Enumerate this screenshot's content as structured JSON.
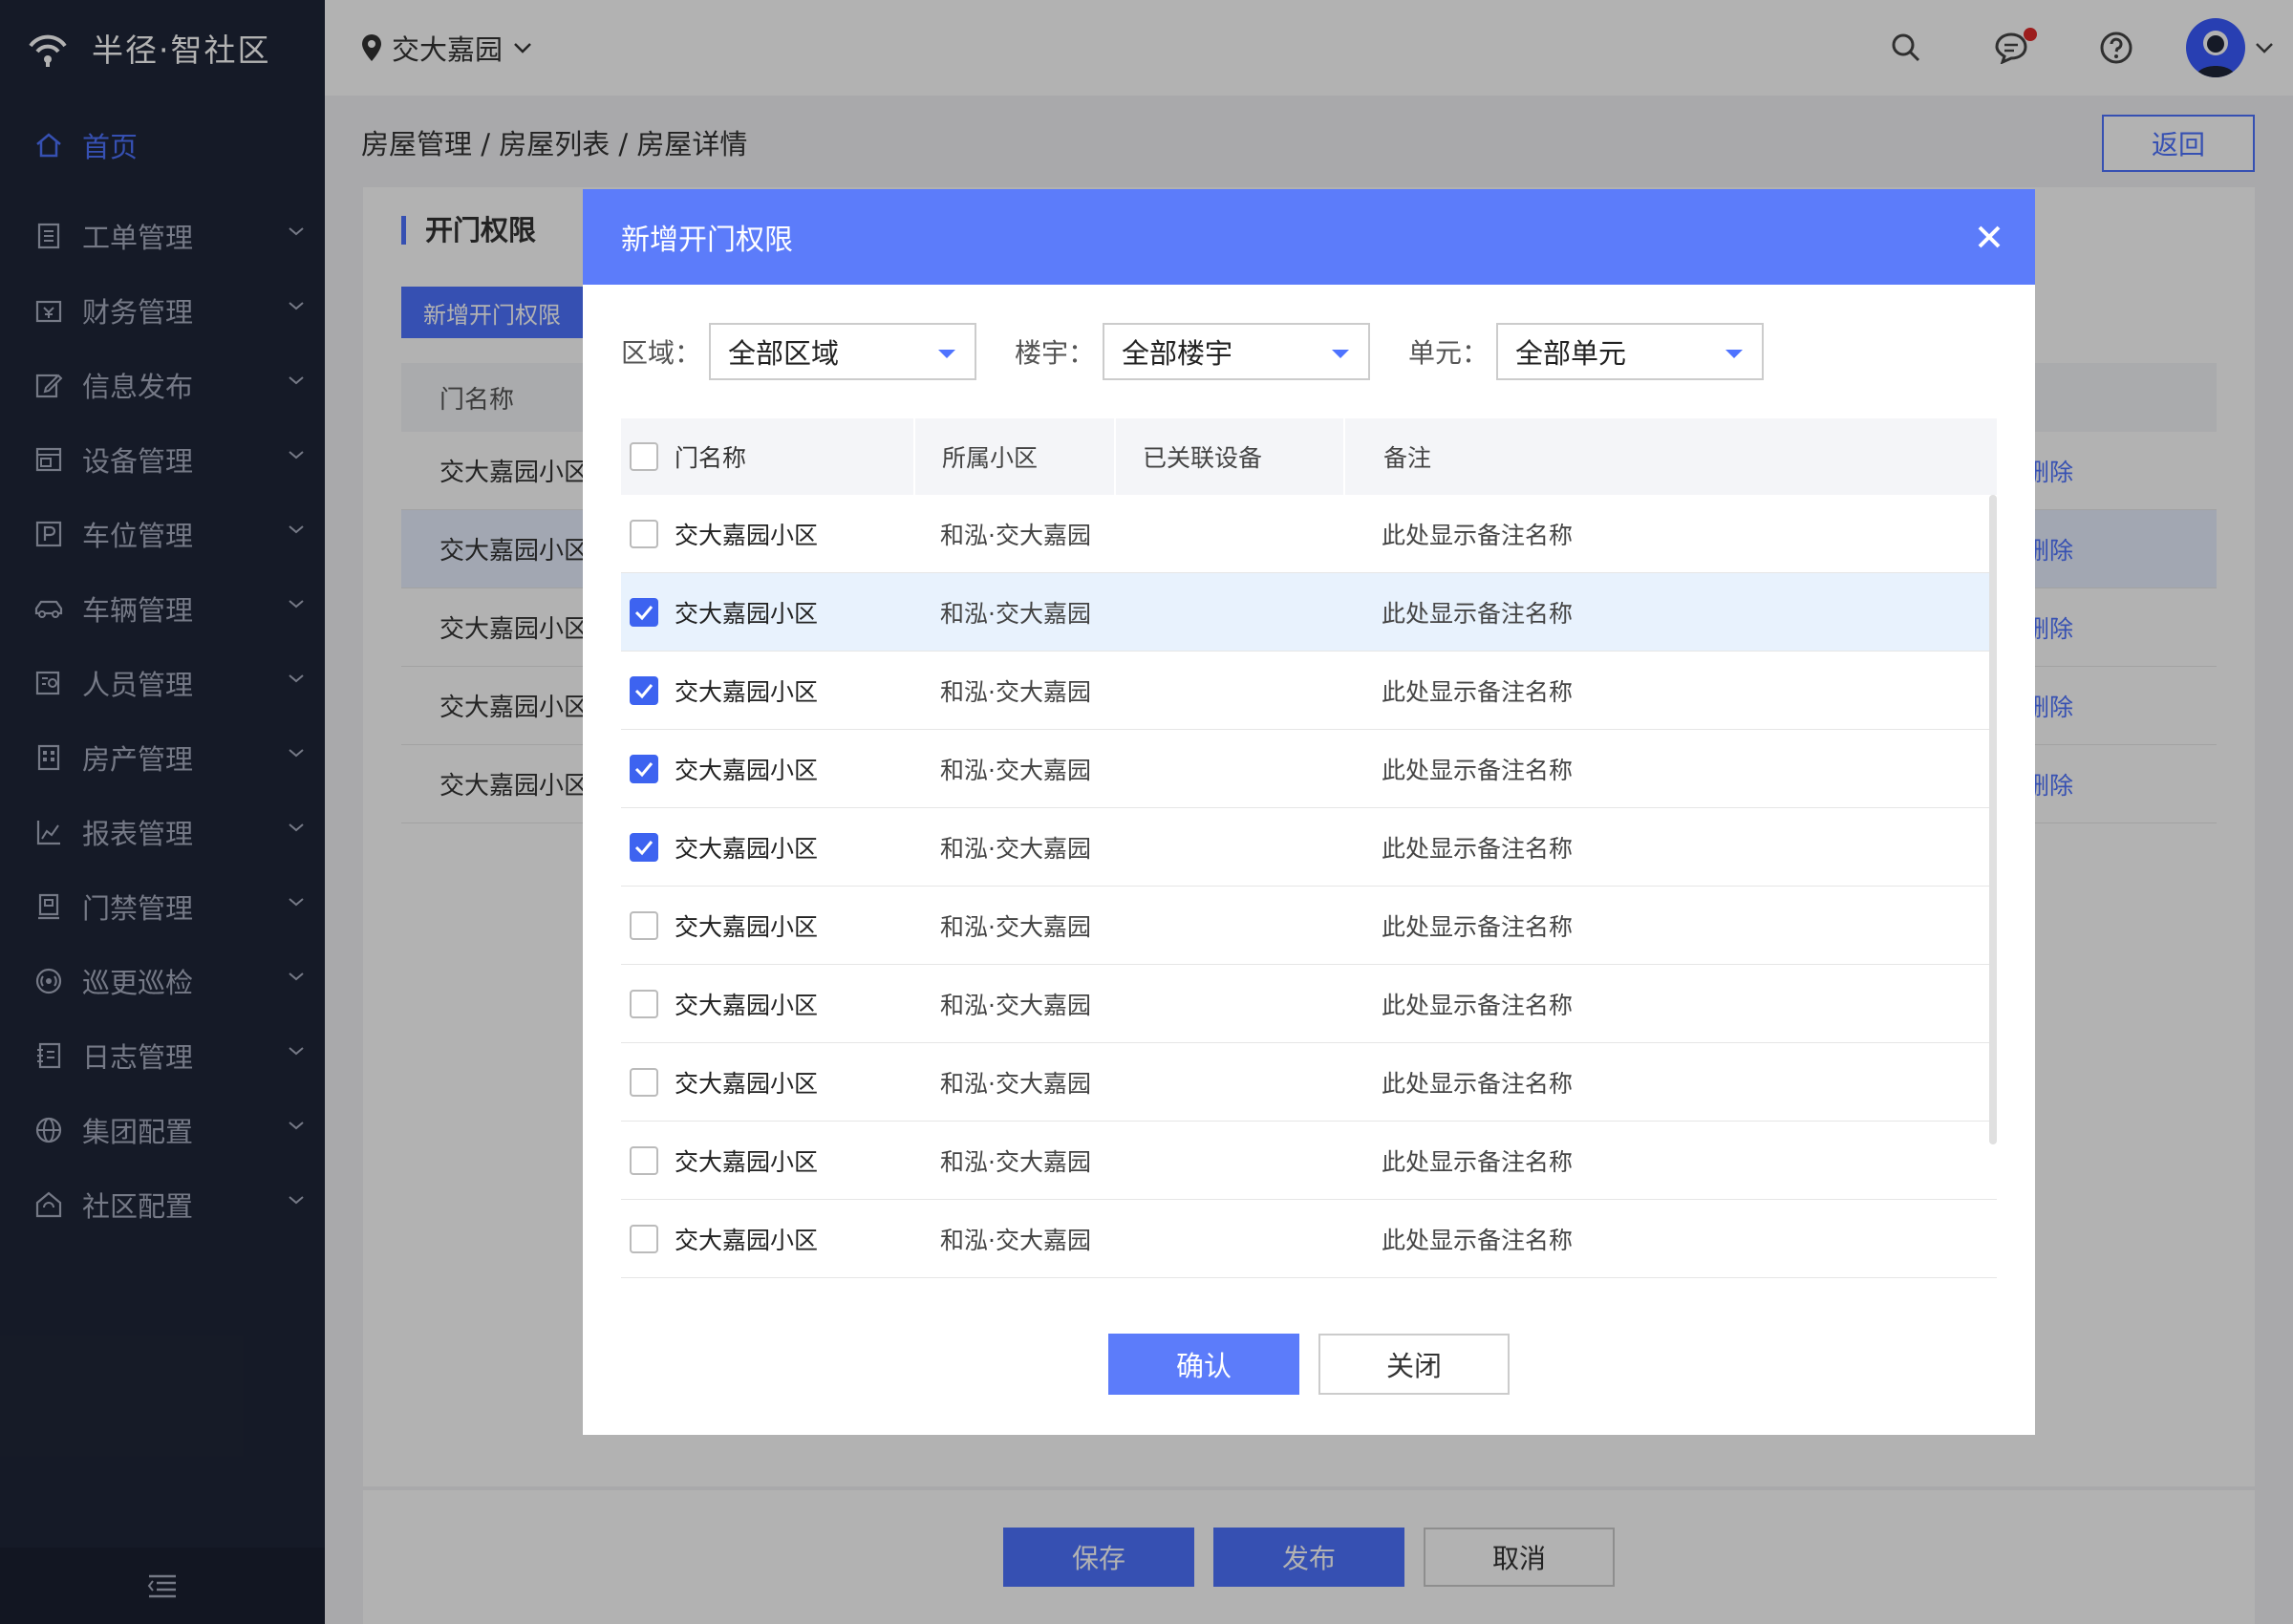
{
  "app": {
    "name": "半径·智社区"
  },
  "sidebar": {
    "items": [
      {
        "label": "首页",
        "icon": "home-icon",
        "active": true
      },
      {
        "label": "工单管理",
        "icon": "ticket-icon"
      },
      {
        "label": "财务管理",
        "icon": "finance-icon"
      },
      {
        "label": "信息发布",
        "icon": "edit-icon"
      },
      {
        "label": "设备管理",
        "icon": "device-icon"
      },
      {
        "label": "车位管理",
        "icon": "parking-icon"
      },
      {
        "label": "车辆管理",
        "icon": "car-icon"
      },
      {
        "label": "人员管理",
        "icon": "person-icon"
      },
      {
        "label": "房产管理",
        "icon": "building-icon"
      },
      {
        "label": "报表管理",
        "icon": "chart-icon"
      },
      {
        "label": "门禁管理",
        "icon": "door-icon"
      },
      {
        "label": "巡更巡检",
        "icon": "patrol-icon"
      },
      {
        "label": "日志管理",
        "icon": "log-icon"
      },
      {
        "label": "集团配置",
        "icon": "globe-icon"
      },
      {
        "label": "社区配置",
        "icon": "community-icon"
      }
    ]
  },
  "header": {
    "location": "交大嘉园"
  },
  "breadcrumb": "房屋管理 /  房屋列表 / 房屋详情",
  "back_label": "返回",
  "panel": {
    "title": "开门权限",
    "add_button": "新增开门权限",
    "column_door": "门名称",
    "rows": [
      "交大嘉园小区",
      "交大嘉园小区",
      "交大嘉园小区",
      "交大嘉园小区",
      "交大嘉园小区"
    ],
    "row_action": "删除"
  },
  "footer": {
    "save": "保存",
    "publish": "发布",
    "cancel": "取消"
  },
  "modal": {
    "title": "新增开门权限",
    "filters": [
      {
        "label": "区域：",
        "value": "全部区域"
      },
      {
        "label": "楼宇：",
        "value": "全部楼宇"
      },
      {
        "label": "单元：",
        "value": "全部单元"
      }
    ],
    "columns": {
      "name": "门名称",
      "community": "所属小区",
      "devices": "已关联设备",
      "note": "备注"
    },
    "rows": [
      {
        "name": "交大嘉园小区",
        "community": "和泓·交大嘉园",
        "devices": "",
        "note": "此处显示备注名称",
        "checked": false
      },
      {
        "name": "交大嘉园小区",
        "community": "和泓·交大嘉园",
        "devices": "",
        "note": "此处显示备注名称",
        "checked": true
      },
      {
        "name": "交大嘉园小区",
        "community": "和泓·交大嘉园",
        "devices": "",
        "note": "此处显示备注名称",
        "checked": true
      },
      {
        "name": "交大嘉园小区",
        "community": "和泓·交大嘉园",
        "devices": "",
        "note": "此处显示备注名称",
        "checked": true
      },
      {
        "name": "交大嘉园小区",
        "community": "和泓·交大嘉园",
        "devices": "",
        "note": "此处显示备注名称",
        "checked": true
      },
      {
        "name": "交大嘉园小区",
        "community": "和泓·交大嘉园",
        "devices": "",
        "note": "此处显示备注名称",
        "checked": false
      },
      {
        "name": "交大嘉园小区",
        "community": "和泓·交大嘉园",
        "devices": "",
        "note": "此处显示备注名称",
        "checked": false
      },
      {
        "name": "交大嘉园小区",
        "community": "和泓·交大嘉园",
        "devices": "",
        "note": "此处显示备注名称",
        "checked": false
      },
      {
        "name": "交大嘉园小区",
        "community": "和泓·交大嘉园",
        "devices": "",
        "note": "此处显示备注名称",
        "checked": false
      },
      {
        "name": "交大嘉园小区",
        "community": "和泓·交大嘉园",
        "devices": "",
        "note": "此处显示备注名称",
        "checked": false
      }
    ],
    "confirm": "确认",
    "close": "关闭"
  },
  "colors": {
    "accent": "#4e73ff",
    "modal_header": "#5c7cfa",
    "sidebar_bg": "#1f2638"
  }
}
